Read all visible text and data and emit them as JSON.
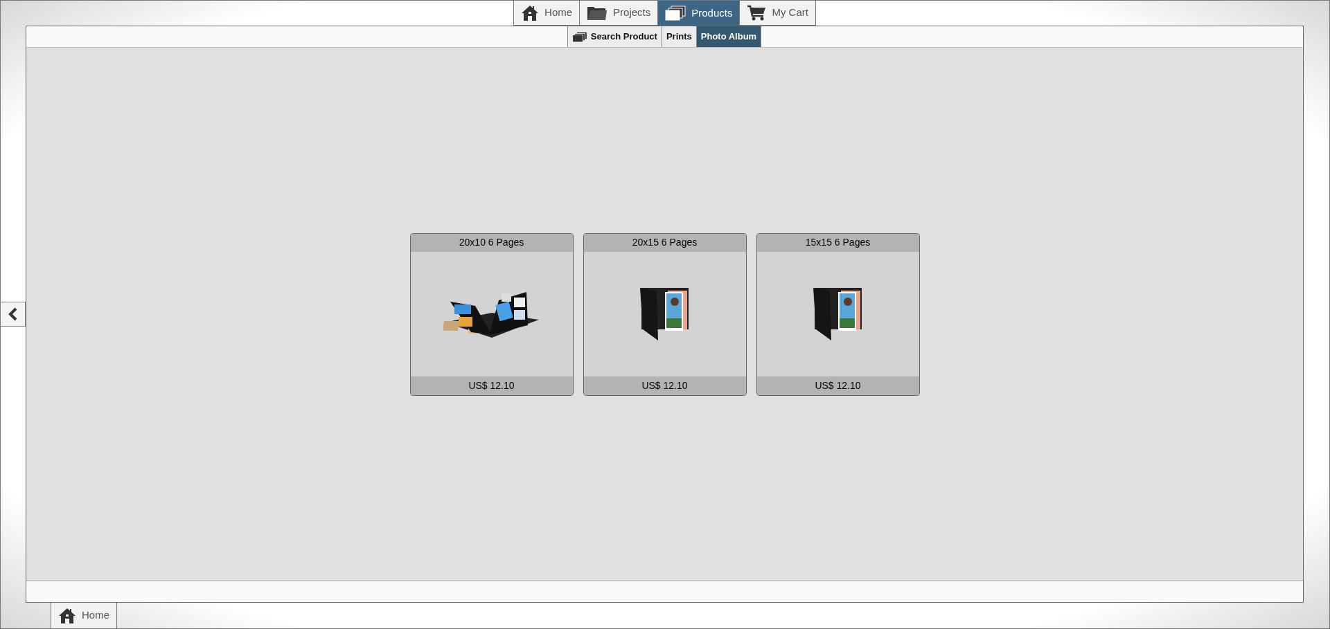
{
  "top_nav": [
    {
      "label": "Home",
      "kind": "home",
      "selected": false
    },
    {
      "label": "Projects",
      "kind": "folder",
      "selected": false
    },
    {
      "label": "Products",
      "kind": "stack",
      "selected": true
    },
    {
      "label": "My Cart",
      "kind": "cart",
      "selected": false
    }
  ],
  "sub_tabs": [
    {
      "label": "Search Product",
      "kind": "stack",
      "selected": false
    },
    {
      "label": "Prints",
      "kind": "plain",
      "selected": false
    },
    {
      "label": "Photo Album",
      "kind": "plain",
      "selected": true
    }
  ],
  "products": [
    {
      "title": "20x10 6 Pages",
      "kind": "open",
      "price": "US$ 12.10"
    },
    {
      "title": "20x15 6 Pages",
      "kind": "closed",
      "price": "US$ 12.10"
    },
    {
      "title": "15x15 6 Pages",
      "kind": "closed",
      "price": "US$ 12.10"
    }
  ],
  "bottom_tab": {
    "label": "Home",
    "kind": "home"
  }
}
